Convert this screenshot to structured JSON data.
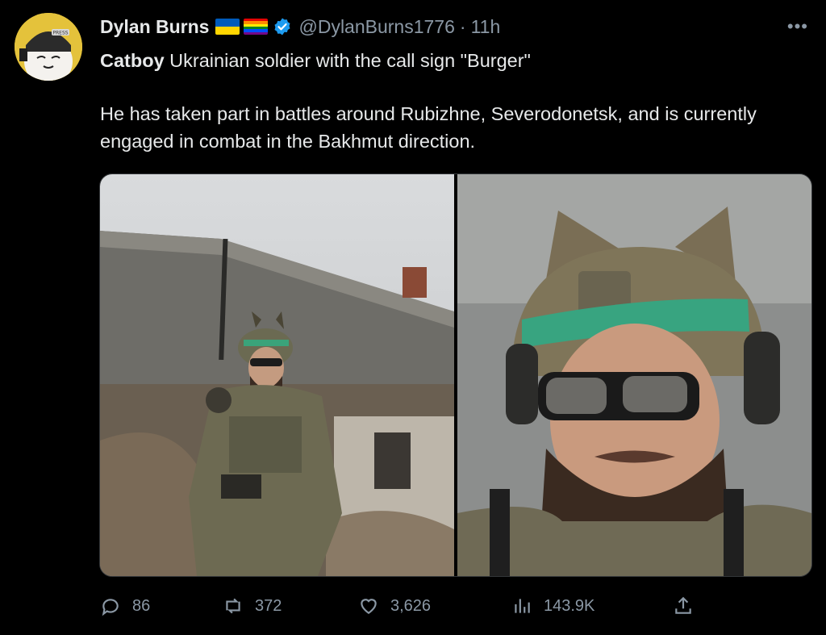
{
  "tweet": {
    "author_name": "Dylan Burns",
    "handle": "@DylanBurns1776",
    "separator": "·",
    "time": "11h",
    "more_label": "•••",
    "avatar_text": "PRESS",
    "line1_bold": "Catboy",
    "line1_rest": " Ukrainian soldier with the call sign \"Burger\"",
    "line2": "He has taken part in battles around Rubizhne, Severodonetsk, and is currently engaged in combat in the Bakhmut direction.",
    "colors": {
      "verified": "#1d9bf0",
      "ua_blue": "#005bbb",
      "ua_yellow": "#ffd500"
    }
  },
  "stats": {
    "replies": "86",
    "retweets": "372",
    "likes": "3,626",
    "views": "143.9K"
  },
  "icons": {
    "reply": "reply-icon",
    "retweet": "retweet-icon",
    "like": "heart-icon",
    "views": "views-icon",
    "share": "share-icon"
  }
}
